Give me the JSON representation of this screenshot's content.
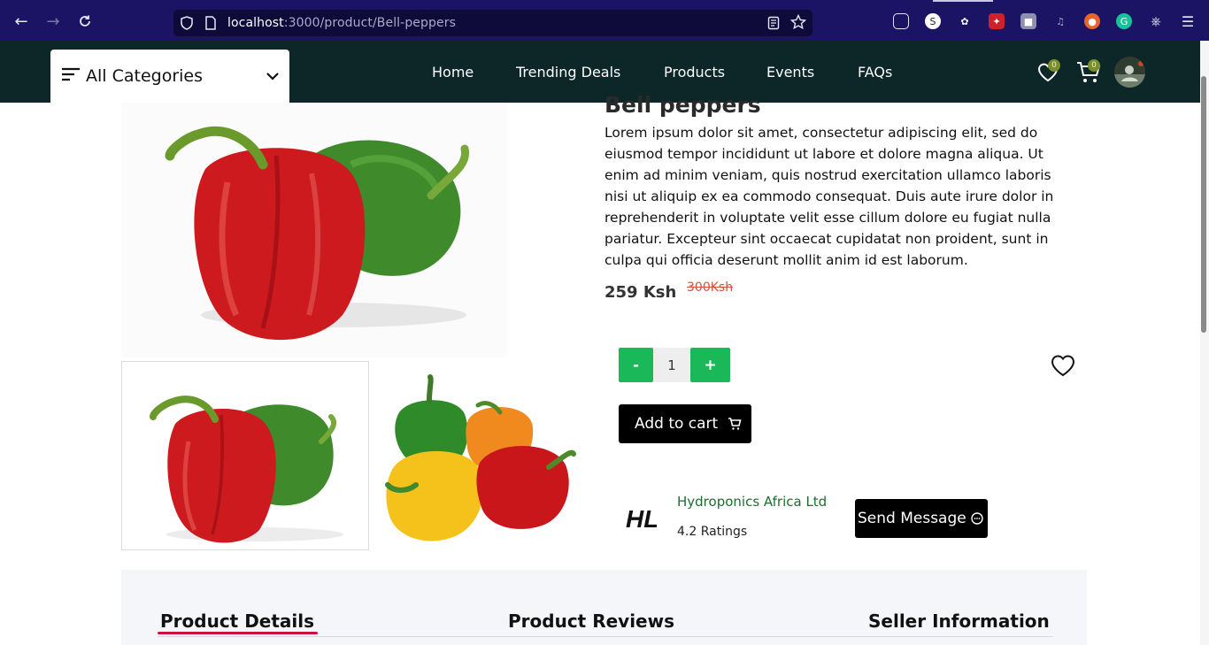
{
  "browser": {
    "url_host": "localhost",
    "url_path": ":3000/product/Bell-peppers"
  },
  "nav": {
    "categories_label": "All Categories",
    "links": [
      "Home",
      "Trending Deals",
      "Products",
      "Events",
      "FAQs"
    ],
    "wishlist_count": "0",
    "cart_count": "0"
  },
  "product": {
    "title": "Bell peppers",
    "description": "Lorem ipsum dolor sit amet, consectetur adipiscing elit, sed do eiusmod tempor incididunt ut labore et dolore magna aliqua. Ut enim ad minim veniam, quis nostrud exercitation ullamco laboris nisi ut aliquip ex ea commodo consequat. Duis aute irure dolor in reprehenderit in voluptate velit esse cillum dolore eu fugiat nulla pariatur. Excepteur sint occaecat cupidatat non proident, sunt in culpa qui officia deserunt mollit anim id est laborum.",
    "price": "259 Ksh",
    "old_price": "300Ksh",
    "quantity": "1",
    "minus_label": "-",
    "plus_label": "+",
    "add_to_cart_label": "Add to cart"
  },
  "seller": {
    "name": "Hydroponics Africa Ltd",
    "rating": "4.2 Ratings",
    "send_message_label": "Send Message"
  },
  "tabs": [
    "Product Details",
    "Product Reviews",
    "Seller Information"
  ],
  "colors": {
    "nav_bg": "#0d2627",
    "browser_bg": "#1b1464",
    "accent_green": "#1bb85a",
    "active_tab": "#c8143c",
    "seller_name": "#1d6e2e",
    "old_price": "#d0533d"
  }
}
